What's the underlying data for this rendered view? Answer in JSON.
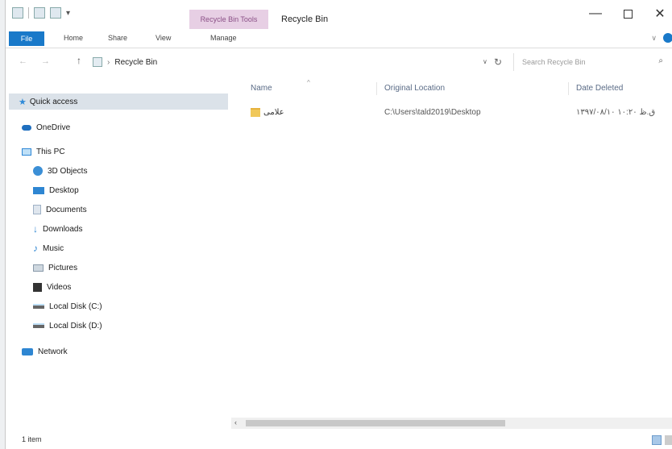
{
  "window": {
    "title": "Recycle Bin",
    "context_tab": "Recycle Bin Tools"
  },
  "ribbon": {
    "tabs": [
      "File",
      "Home",
      "Share",
      "View",
      "Manage"
    ]
  },
  "address": {
    "crumb": "Recycle Bin",
    "search_placeholder": "Search Recycle Bin"
  },
  "nav": {
    "items": [
      {
        "label": "Quick access",
        "icon": "star-icon"
      },
      {
        "label": "OneDrive",
        "icon": "cloud-icon"
      },
      {
        "label": "This PC",
        "icon": "computer-icon"
      },
      {
        "label": "3D Objects",
        "icon": "cube-icon"
      },
      {
        "label": "Desktop",
        "icon": "desktop-icon"
      },
      {
        "label": "Documents",
        "icon": "document-icon"
      },
      {
        "label": "Downloads",
        "icon": "download-icon"
      },
      {
        "label": "Music",
        "icon": "music-icon"
      },
      {
        "label": "Pictures",
        "icon": "picture-icon"
      },
      {
        "label": "Videos",
        "icon": "video-icon"
      },
      {
        "label": "Local Disk (C:)",
        "icon": "disk-icon"
      },
      {
        "label": "Local Disk (D:)",
        "icon": "disk-icon"
      },
      {
        "label": "Network",
        "icon": "network-icon"
      }
    ]
  },
  "columns": {
    "name": "Name",
    "location": "Original Location",
    "date": "Date Deleted"
  },
  "files": [
    {
      "name": "علامی",
      "location": "C:\\Users\\tald2019\\Desktop",
      "date": "۱۳۹۷/۰۸/۱۰ ق.ظ ۱۰:۲۰"
    }
  ],
  "status": {
    "count": "1 item"
  },
  "colors": {
    "accent": "#1979c9",
    "context_tab": "#e7cfe4",
    "selected": "#dbe2e9"
  }
}
